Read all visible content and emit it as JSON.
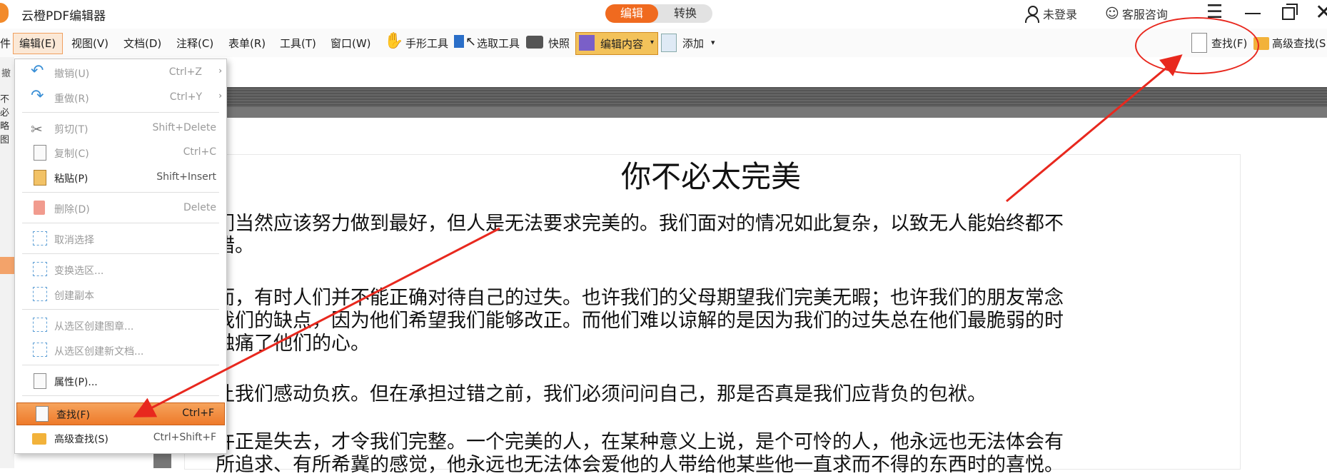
{
  "app": {
    "title": "云橙PDF编辑器"
  },
  "mode_switch": {
    "edit": "编辑",
    "convert": "转换"
  },
  "header": {
    "login": "未登录",
    "service": "客服咨询"
  },
  "menubar": {
    "edge": "件",
    "edit": "编辑(E)",
    "view": "视图(V)",
    "document": "文档(D)",
    "comment": "注释(C)",
    "form": "表单(R)",
    "tools": "工具(T)",
    "window": "窗口(W)",
    "hand_tool": "手形工具",
    "select_tool": "选取工具",
    "snapshot": "快照",
    "edit_content": "编辑内容",
    "add": "添加",
    "find": "查找(F)",
    "advanced_find": "高级查找(S"
  },
  "left_strip": {
    "t1": "撤",
    "t2": "不必",
    "t3": "略图"
  },
  "edit_menu": {
    "items": [
      {
        "label": "撤销(U)",
        "shortcut": "Ctrl+Z"
      },
      {
        "label": "重做(R)",
        "shortcut": "Ctrl+Y"
      },
      {
        "label": "剪切(T)",
        "shortcut": "Shift+Delete"
      },
      {
        "label": "复制(C)",
        "shortcut": "Ctrl+C"
      },
      {
        "label": "粘贴(P)",
        "shortcut": "Shift+Insert"
      },
      {
        "label": "删除(D)",
        "shortcut": "Delete"
      },
      {
        "label": "取消选择",
        "shortcut": ""
      },
      {
        "label": "变换选区...",
        "shortcut": ""
      },
      {
        "label": "创建副本",
        "shortcut": ""
      },
      {
        "label": "从选区创建图章...",
        "shortcut": ""
      },
      {
        "label": "从选区创建新文档...",
        "shortcut": ""
      },
      {
        "label": "属性(P)...",
        "shortcut": ""
      },
      {
        "label": "查找(F)",
        "shortcut": "Ctrl+F"
      },
      {
        "label": "高级查找(S)",
        "shortcut": "Ctrl+Shift+F"
      }
    ]
  },
  "document": {
    "title": "你不必太完美",
    "p1_l1": "们当然应该努力做到最好，但人是无法要求完美的。我们面对的情况如此复杂，以致无人能始终都不",
    "p1_l2": "错。",
    "p2_l1": "而，有时人们并不能正确对待自己的过失。也许我们的父母期望我们完美无暇；也许我们的朋友常念",
    "p2_l2": "我们的缺点，因为他们希望我们能够改正。而他们难以谅解的是因为我们的过失总在他们最脆弱的时",
    "p2_l3": "触痛了他们的心。",
    "p3_l1": "让我们感动负疚。但在承担过错之前，我们必须问问自己，那是否真是我们应背负的包袱。",
    "p4_l1": "许正是失去，才令我们完整。一个完美的人，在某种意义上说，是个可怜的人，他永远也无法体会有",
    "p4_l2": "所追求、有所希冀的感觉，他永远也无法体会爱他的人带给他某些他一直求而不得的东西时的喜悦。"
  },
  "colors": {
    "accent": "#f06a1f",
    "annotation": "#e8281e"
  }
}
